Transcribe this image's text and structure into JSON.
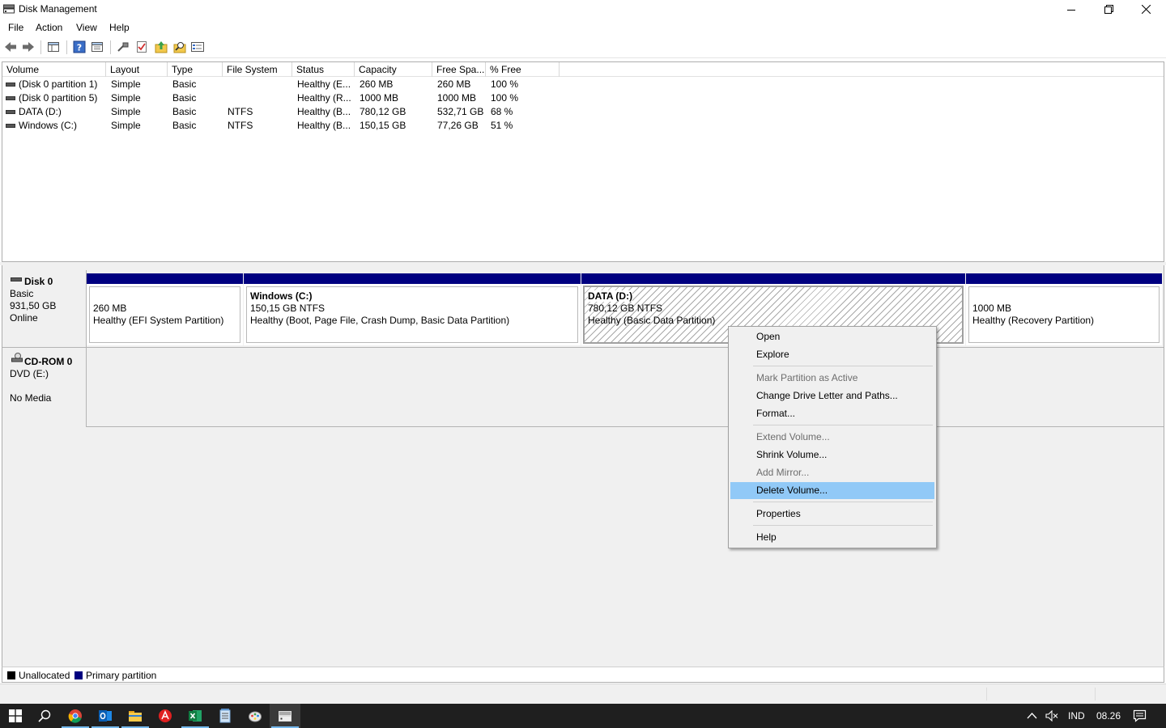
{
  "window": {
    "title": "Disk Management"
  },
  "menu": [
    "File",
    "Action",
    "View",
    "Help"
  ],
  "toolbar": {
    "icons": [
      "back-arrow-icon",
      "forward-arrow-icon",
      "console-tree-icon",
      "help-icon",
      "properties-icon",
      "connect-icon",
      "check-icon",
      "folder-up-icon",
      "find-icon",
      "list-view-icon"
    ]
  },
  "volume_table": {
    "columns": [
      "Volume",
      "Layout",
      "Type",
      "File System",
      "Status",
      "Capacity",
      "Free Spa...",
      "% Free"
    ],
    "rows": [
      [
        "(Disk 0 partition 1)",
        "Simple",
        "Basic",
        "",
        "Healthy (E...",
        "260 MB",
        "260 MB",
        "100 %"
      ],
      [
        "(Disk 0 partition 5)",
        "Simple",
        "Basic",
        "",
        "Healthy (R...",
        "1000 MB",
        "1000 MB",
        "100 %"
      ],
      [
        "DATA (D:)",
        "Simple",
        "Basic",
        "NTFS",
        "Healthy (B...",
        "780,12 GB",
        "532,71 GB",
        "68 %"
      ],
      [
        "Windows (C:)",
        "Simple",
        "Basic",
        "NTFS",
        "Healthy (B...",
        "150,15 GB",
        "77,26 GB",
        "51 %"
      ]
    ]
  },
  "disk0": {
    "name": "Disk 0",
    "type": "Basic",
    "size": "931,50 GB",
    "state": "Online",
    "partitions": [
      {
        "title": "",
        "size": "260 MB",
        "status": "Healthy (EFI System Partition)"
      },
      {
        "title": "Windows  (C:)",
        "size": "150,15 GB NTFS",
        "status": "Healthy (Boot, Page File, Crash Dump, Basic Data Partition)"
      },
      {
        "title": "DATA  (D:)",
        "size": "780,12 GB NTFS",
        "status": "Healthy (Basic Data Partition)"
      },
      {
        "title": "",
        "size": "1000 MB",
        "status": "Healthy (Recovery Partition)"
      }
    ]
  },
  "cdrom0": {
    "name": "CD-ROM 0",
    "drive": "DVD (E:)",
    "media": "No Media"
  },
  "legend": {
    "unallocated": "Unallocated",
    "primary": "Primary partition",
    "unallocated_color": "#000000",
    "primary_color": "#000080"
  },
  "context_menu": {
    "items": [
      {
        "label": "Open",
        "enabled": true
      },
      {
        "label": "Explore",
        "enabled": true
      },
      {
        "label": "Mark Partition as Active",
        "enabled": false
      },
      {
        "label": "Change Drive Letter and Paths...",
        "enabled": true
      },
      {
        "label": "Format...",
        "enabled": true
      },
      {
        "label": "Extend Volume...",
        "enabled": false
      },
      {
        "label": "Shrink Volume...",
        "enabled": true
      },
      {
        "label": "Add Mirror...",
        "enabled": false
      },
      {
        "label": "Delete Volume...",
        "enabled": true,
        "highlighted": true
      },
      {
        "label": "Properties",
        "enabled": true
      },
      {
        "label": "Help",
        "enabled": true
      }
    ]
  },
  "taskbar": {
    "apps": [
      "start-icon",
      "search-icon",
      "chrome-icon",
      "outlook-icon",
      "file-explorer-icon",
      "acrobat-icon",
      "excel-icon",
      "notepad-icon",
      "paint-icon",
      "disk-management-icon"
    ],
    "tray": {
      "language": "IND",
      "time": "08.26"
    }
  }
}
